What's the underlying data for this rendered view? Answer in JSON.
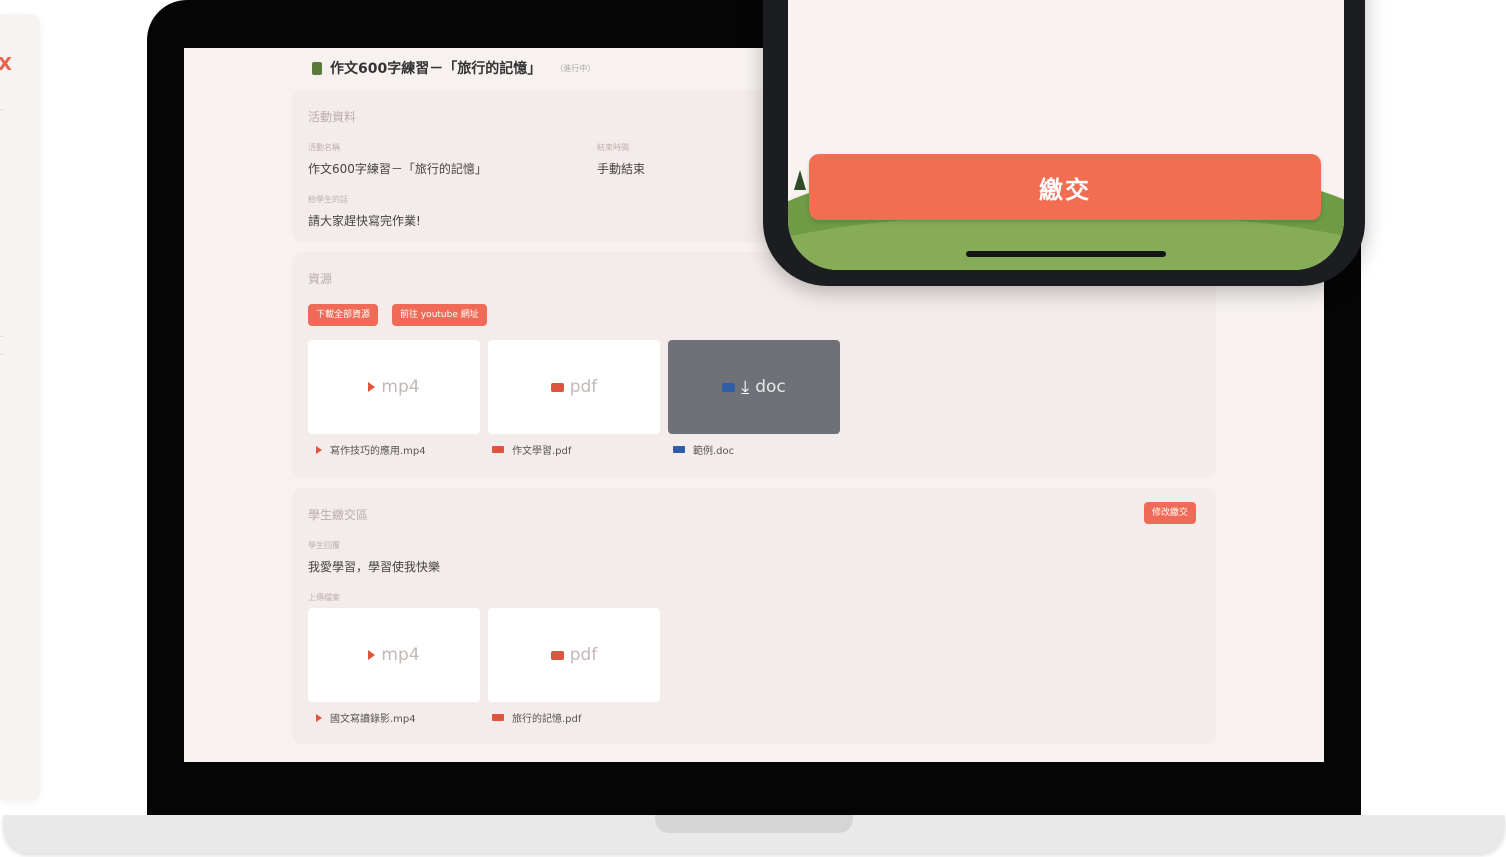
{
  "side": {
    "mark": "X"
  },
  "header": {
    "title": "作文600字練習－「旅行的記憶」",
    "tag": "（進行中）"
  },
  "info": {
    "heading": "活動資料",
    "name_label": "活動名稱",
    "name_value": "作文600字練習－「旅行的記憶」",
    "end_label": "結束時間",
    "end_value": "手動結束",
    "desc_label": "給學生的話",
    "desc_value": "請大家趕快寫完作業!"
  },
  "resources": {
    "heading": "資源",
    "download_all": "下載全部資源",
    "youtube_link": "前往 youtube 網址",
    "files": [
      {
        "type": "mp4",
        "name": "寫作技巧的應用.mp4"
      },
      {
        "type": "pdf",
        "name": "作文學習.pdf"
      },
      {
        "type": "doc",
        "name": "範例.doc"
      }
    ]
  },
  "student": {
    "heading": "學生繳交區",
    "edit_button": "修改繳交",
    "answer_label": "學生回覆",
    "answer_value": "我愛學習，學習使我快樂",
    "upload_label": "上傳檔案",
    "files": [
      {
        "type": "mp4",
        "name": "國文寫讀錄影.mp4"
      },
      {
        "type": "pdf",
        "name": "旅行的記憶.pdf"
      }
    ]
  },
  "phone": {
    "submit_label": "繳交"
  },
  "colors": {
    "accent": "#ef6b57",
    "screen_bg": "#f7f2f0",
    "section_bg": "#f4ecea"
  }
}
